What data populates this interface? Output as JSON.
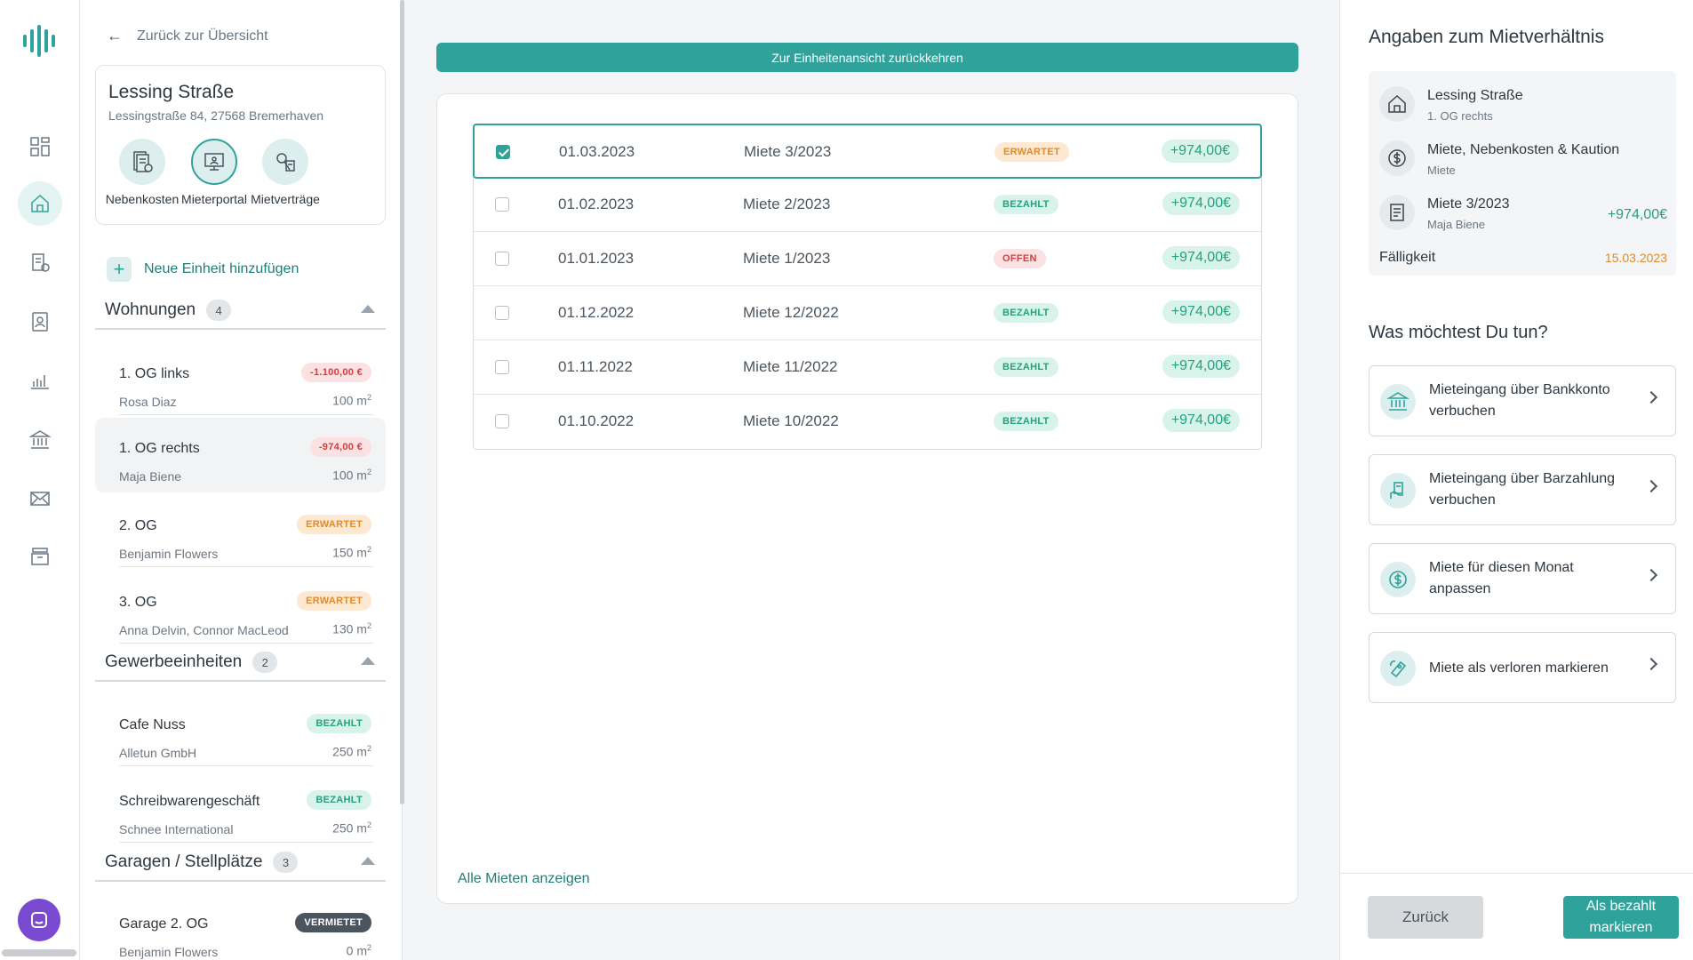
{
  "nav": {
    "back_label": "Zurück zur Übersicht"
  },
  "property": {
    "name": "Lessing Straße",
    "address": "Lessingstraße 84, 27568 Bremerhaven",
    "quick_actions": [
      "Nebenkosten",
      "Mieterportal",
      "Mietverträge"
    ]
  },
  "add_unit_label": "Neue Einheit hinzufügen",
  "groups": {
    "wohnungen": {
      "name": "Wohnungen",
      "count": "4",
      "units": [
        {
          "name": "1. OG links",
          "tenant": "Rosa Diaz",
          "area": "100 m",
          "badge": "-1.100,00 €"
        },
        {
          "name": "1. OG rechts",
          "tenant": "Maja Biene",
          "area": "100 m",
          "badge": "-974,00 €"
        },
        {
          "name": "2. OG",
          "tenant": "Benjamin Flowers",
          "area": "150 m",
          "badge": "ERWARTET"
        },
        {
          "name": "3. OG",
          "tenant": "Anna Delvin, Connor MacLeod",
          "area": "130 m",
          "badge": "ERWARTET"
        }
      ]
    },
    "gewerbe": {
      "name": "Gewerbeeinheiten",
      "count": "2",
      "units": [
        {
          "name": "Cafe Nuss",
          "tenant": "Alletun GmbH",
          "area": "250 m",
          "badge": "BEZAHLT"
        },
        {
          "name": "Schreibwarengeschäft",
          "tenant": "Schnee International",
          "area": "250 m",
          "badge": "BEZAHLT"
        }
      ]
    },
    "garagen": {
      "name": "Garagen / Stellplätze",
      "count": "3",
      "units": [
        {
          "name": "Garage 2. OG",
          "tenant": "Benjamin Flowers",
          "area": "0 m",
          "badge": "VERMIETET"
        }
      ]
    }
  },
  "area_sup": "2",
  "banner_label": "Zur Einheitenansicht zurückkehren",
  "rents": [
    {
      "date": "01.03.2023",
      "name": "Miete 3/2023",
      "status": "ERWARTET",
      "amount": "+974,00€",
      "checked": true
    },
    {
      "date": "01.02.2023",
      "name": "Miete 2/2023",
      "status": "BEZAHLT",
      "amount": "+974,00€",
      "checked": false
    },
    {
      "date": "01.01.2023",
      "name": "Miete 1/2023",
      "status": "OFFEN",
      "amount": "+974,00€",
      "checked": false
    },
    {
      "date": "01.12.2022",
      "name": "Miete 12/2022",
      "status": "BEZAHLT",
      "amount": "+974,00€",
      "checked": false
    },
    {
      "date": "01.11.2022",
      "name": "Miete 11/2022",
      "status": "BEZAHLT",
      "amount": "+974,00€",
      "checked": false
    },
    {
      "date": "01.10.2022",
      "name": "Miete 10/2022",
      "status": "BEZAHLT",
      "amount": "+974,00€",
      "checked": false
    }
  ],
  "all_rents_label": "Alle Mieten anzeigen",
  "details": {
    "title": "Angaben zum Mietverhältnis",
    "unit_title": "Lessing Straße",
    "unit_sub": "1. OG rechts",
    "type_title": "Miete, Nebenkosten & Kaution",
    "type_sub": "Miete",
    "rent_title": "Miete 3/2023",
    "rent_sub": "Maja Biene",
    "rent_amount": "+974,00€",
    "due_label": "Fälligkeit",
    "due_value": "15.03.2023"
  },
  "actions": {
    "title": "Was möchtest Du tun?",
    "items": [
      {
        "label": "Mieteingang über Bankkonto verbuchen",
        "icon": "bank-icon"
      },
      {
        "label": "Mieteingang über Barzahlung verbuchen",
        "icon": "cash-hand-icon"
      },
      {
        "label": "Miete für diesen Monat anpassen",
        "icon": "dollar-circle-icon"
      },
      {
        "label": "Miete als verloren markieren",
        "icon": "ticket-icon"
      }
    ]
  },
  "footer": {
    "back_label": "Zurück",
    "paid_label": "Als bezahlt markieren"
  },
  "colors": {
    "accent": "#2fa39b",
    "paid": "#26a07e",
    "expected": "#e08a2a",
    "overdue": "#d13e3e",
    "chat": "#7a4bd0"
  }
}
